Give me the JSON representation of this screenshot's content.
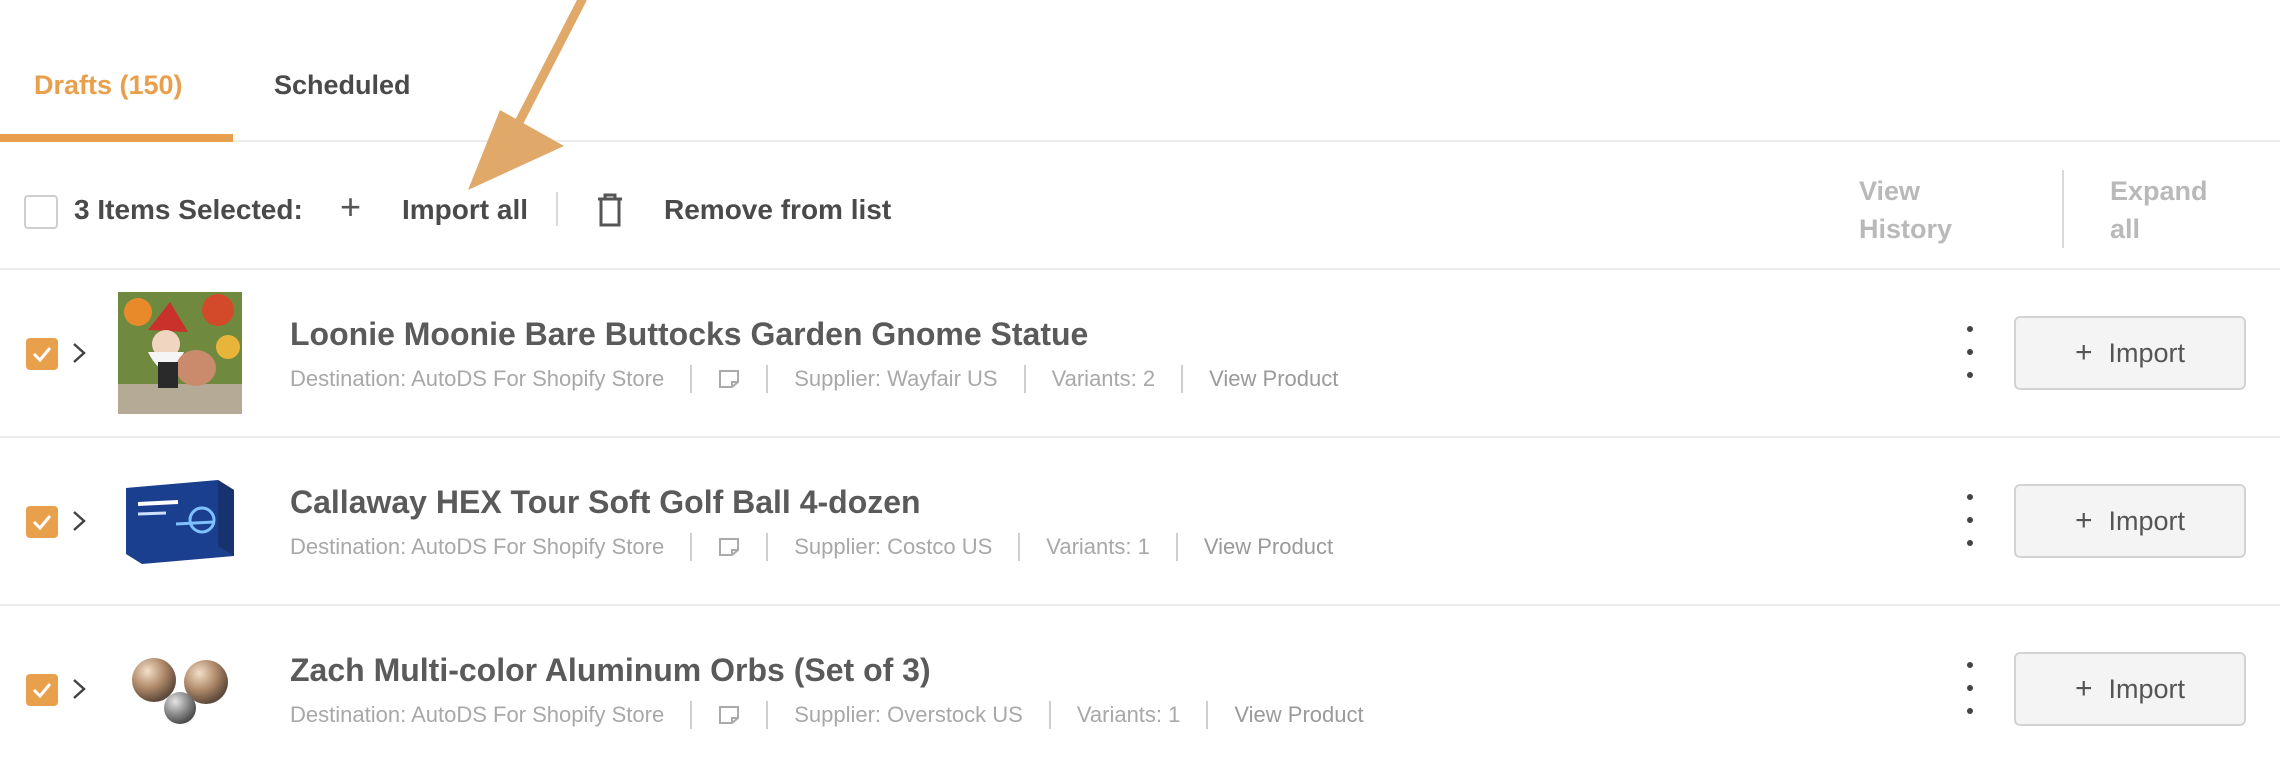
{
  "tabs": {
    "drafts": "Drafts (150)",
    "scheduled": "Scheduled"
  },
  "toolbar": {
    "selected_label": "3 Items Selected:",
    "import_all": "Import all",
    "remove": "Remove from list",
    "view_history_1": "View",
    "view_history_2": "History",
    "expand_1": "Expand",
    "expand_2": "all"
  },
  "products": [
    {
      "title": "Loonie Moonie Bare Buttocks Garden Gnome Statue",
      "destination": "Destination: AutoDS For Shopify Store",
      "supplier": "Supplier: Wayfair US",
      "variants": "Variants: 2",
      "view": "View Product",
      "import": "Import"
    },
    {
      "title": "Callaway HEX Tour Soft Golf Ball 4-dozen",
      "destination": "Destination: AutoDS For Shopify Store",
      "supplier": "Supplier: Costco US",
      "variants": "Variants: 1",
      "view": "View Product",
      "import": "Import"
    },
    {
      "title": "Zach Multi-color Aluminum Orbs (Set of 3)",
      "destination": "Destination: AutoDS For Shopify Store",
      "supplier": "Supplier: Overstock US",
      "variants": "Variants: 1",
      "view": "View Product",
      "import": "Import"
    }
  ],
  "colors": {
    "accent": "#e8a04c",
    "arrow": "#e0a96a"
  }
}
